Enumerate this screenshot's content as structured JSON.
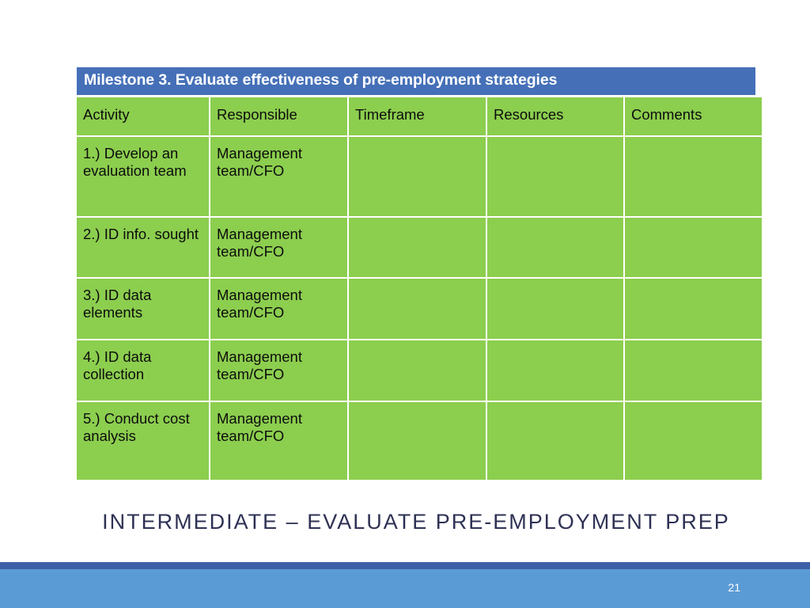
{
  "slide": {
    "page_number": "21",
    "title": "INTERMEDIATE – EVALUATE PRE-EMPLOYMENT PREP"
  },
  "colors": {
    "milestone_bar": "#4570B8",
    "table_cell": "#8CCE4E",
    "title_text": "#2E3154",
    "footer_rule": "#3E5FA8",
    "footer_band": "#5B9BD5",
    "page_number_text": "#FFFFFF"
  },
  "table": {
    "milestone_heading": "Milestone 3.  Evaluate effectiveness of pre-employment strategies",
    "columns": [
      "Activity",
      "Responsible",
      "Timeframe",
      "Resources",
      "Comments"
    ],
    "rows": [
      {
        "activity": "1.) Develop an evaluation team",
        "responsible": "Management team/CFO",
        "timeframe": "",
        "resources": "",
        "comments": ""
      },
      {
        "activity": "2.) ID info. sought",
        "responsible": "Management team/CFO",
        "timeframe": "",
        "resources": "",
        "comments": ""
      },
      {
        "activity": "3.) ID data elements",
        "responsible": "Management team/CFO",
        "timeframe": "",
        "resources": "",
        "comments": ""
      },
      {
        "activity": "4.) ID data collection",
        "responsible": "Management team/CFO",
        "timeframe": "",
        "resources": "",
        "comments": ""
      },
      {
        "activity": "5.)  Conduct cost analysis",
        "responsible": "Management team/CFO",
        "timeframe": "",
        "resources": "",
        "comments": ""
      }
    ]
  }
}
